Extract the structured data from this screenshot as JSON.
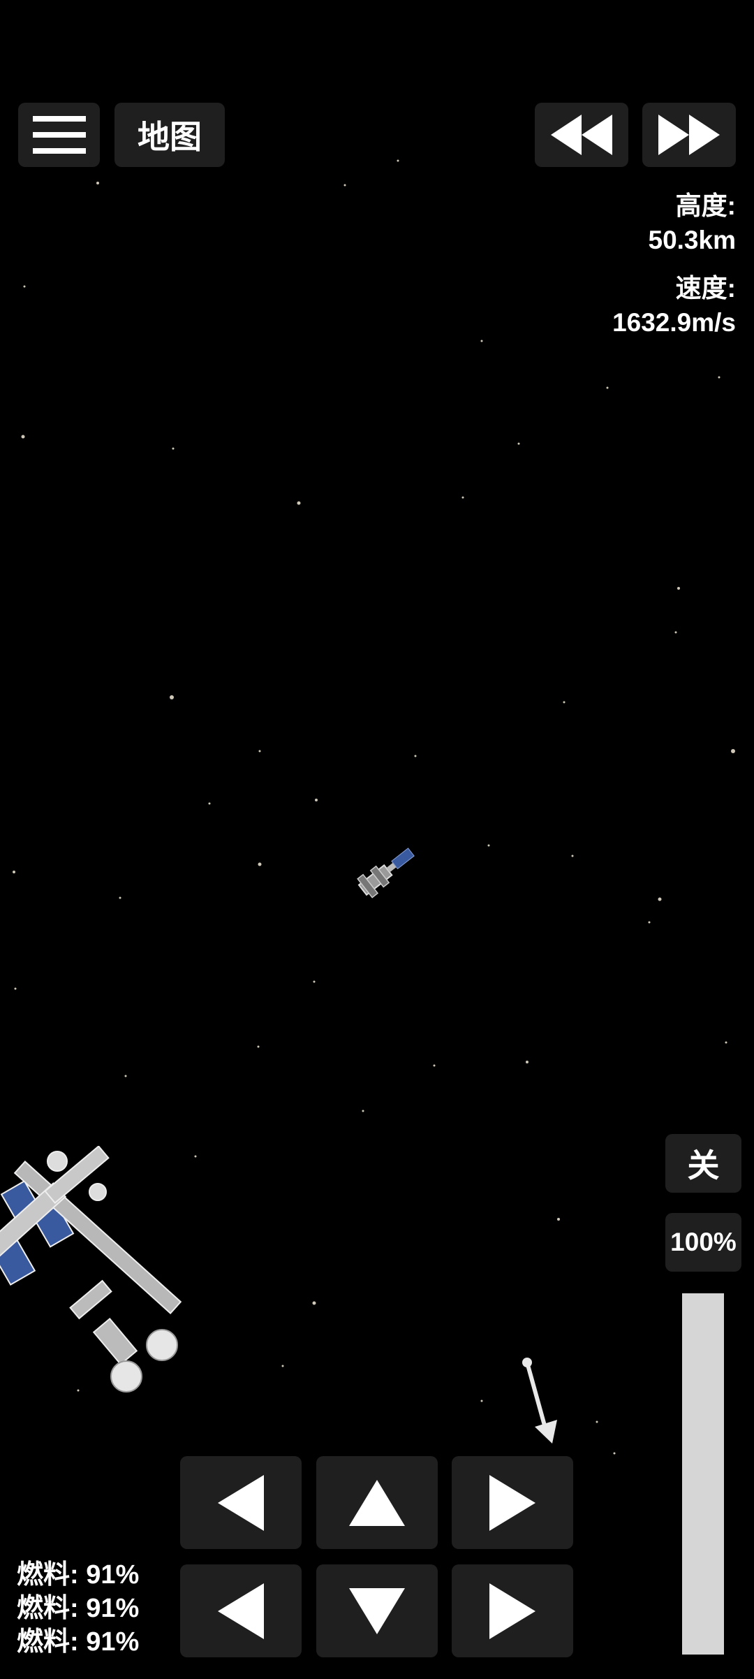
{
  "header": {
    "menu_icon": "hamburger-menu-icon",
    "map_label": "地图",
    "rewind_icon": "rewind-icon",
    "fast_forward_icon": "fast-forward-icon"
  },
  "telemetry": {
    "altitude_label": "高度:",
    "altitude_value": "50.3km",
    "velocity_label": "速度:",
    "velocity_value": "1632.9m/s"
  },
  "throttle": {
    "toggle_label": "关",
    "percent_label": "100%",
    "level": 1.0
  },
  "controls": {
    "icons": [
      "rotate-left-icon",
      "thrust-up-icon",
      "rotate-right-icon",
      "move-left-icon",
      "thrust-down-icon",
      "move-right-icon"
    ]
  },
  "fuel": [
    "燃料: 91%",
    "燃料: 91%",
    "燃料: 91%"
  ],
  "colors": {
    "background": "#000000",
    "button": "#1f1f1f",
    "throttle_fill": "#d6d6d6",
    "solar_panel": "#3a5aa0"
  }
}
